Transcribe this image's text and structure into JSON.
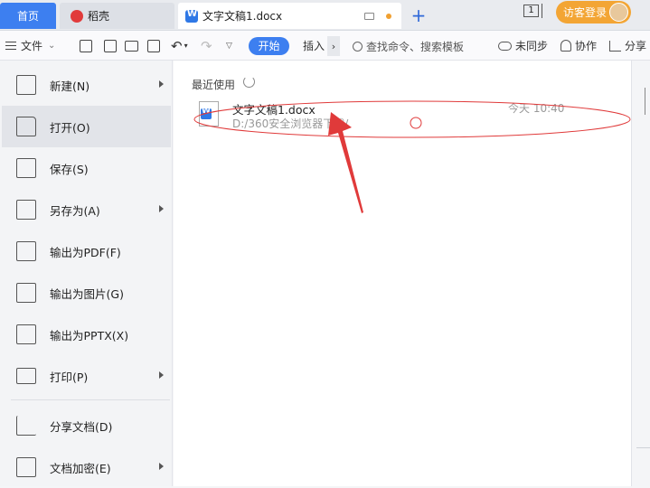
{
  "tabs": {
    "home": "首页",
    "daoke": "稻壳",
    "document": "文字文稿1.docx",
    "new_tab": "+"
  },
  "titlebar": {
    "window_count": "1",
    "login": "访客登录"
  },
  "toolbar": {
    "file_menu": "文件",
    "start": "开始",
    "insert": "插入",
    "search_placeholder": "查找命令、搜索模板",
    "sync": "未同步",
    "collaborate": "协作",
    "share": "分享"
  },
  "menu": {
    "items": [
      {
        "label": "新建(N)",
        "icon": "new-icon",
        "has_submenu": true
      },
      {
        "label": "打开(O)",
        "icon": "folder-open-icon",
        "has_submenu": false,
        "active": true
      },
      {
        "label": "保存(S)",
        "icon": "save-icon",
        "has_submenu": false
      },
      {
        "label": "另存为(A)",
        "icon": "save-as-icon",
        "has_submenu": true
      },
      {
        "label": "输出为PDF(F)",
        "icon": "pdf-icon",
        "has_submenu": false
      },
      {
        "label": "输出为图片(G)",
        "icon": "image-icon",
        "has_submenu": false
      },
      {
        "label": "输出为PPTX(X)",
        "icon": "pptx-icon",
        "has_submenu": false
      },
      {
        "label": "打印(P)",
        "icon": "print-icon",
        "has_submenu": true
      },
      {
        "label": "分享文档(D)",
        "icon": "share-doc-icon",
        "has_submenu": false
      },
      {
        "label": "文档加密(E)",
        "icon": "encrypt-icon",
        "has_submenu": true
      }
    ]
  },
  "recent": {
    "title": "最近使用",
    "files": [
      {
        "name": "文字文稿1.docx",
        "path": "D:/360安全浏览器下载/",
        "time": "今天 10:40"
      }
    ]
  },
  "colors": {
    "accent": "#3d7ff0",
    "login": "#f3a534",
    "annotation": "#e03a3a"
  }
}
